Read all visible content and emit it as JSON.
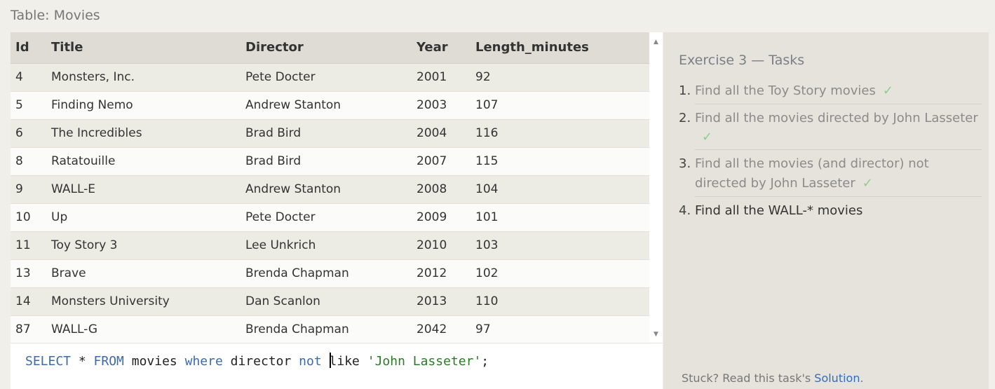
{
  "table": {
    "title": "Table: Movies",
    "columns": [
      "Id",
      "Title",
      "Director",
      "Year",
      "Length_minutes"
    ],
    "rows": [
      [
        "4",
        "Monsters, Inc.",
        "Pete Docter",
        "2001",
        "92"
      ],
      [
        "5",
        "Finding Nemo",
        "Andrew Stanton",
        "2003",
        "107"
      ],
      [
        "6",
        "The Incredibles",
        "Brad Bird",
        "2004",
        "116"
      ],
      [
        "8",
        "Ratatouille",
        "Brad Bird",
        "2007",
        "115"
      ],
      [
        "9",
        "WALL-E",
        "Andrew Stanton",
        "2008",
        "104"
      ],
      [
        "10",
        "Up",
        "Pete Docter",
        "2009",
        "101"
      ],
      [
        "11",
        "Toy Story 3",
        "Lee Unkrich",
        "2010",
        "103"
      ],
      [
        "13",
        "Brave",
        "Brenda Chapman",
        "2012",
        "102"
      ],
      [
        "14",
        "Monsters University",
        "Dan Scanlon",
        "2013",
        "110"
      ],
      [
        "87",
        "WALL-G",
        "Brenda Chapman",
        "2042",
        "97"
      ]
    ]
  },
  "scrollbar": {
    "up_icon": "triangle-up-icon",
    "down_icon": "triangle-down-icon"
  },
  "editor": {
    "tokens": [
      {
        "text": "SELECT",
        "type": "kw"
      },
      {
        "text": " * ",
        "type": "plain"
      },
      {
        "text": "FROM",
        "type": "kw"
      },
      {
        "text": " movies ",
        "type": "plain"
      },
      {
        "text": "where",
        "type": "kw"
      },
      {
        "text": " director ",
        "type": "plain"
      },
      {
        "text": "not",
        "type": "kw"
      },
      {
        "text": " ",
        "type": "plain"
      },
      {
        "text": "",
        "type": "cursor"
      },
      {
        "text": "like",
        "type": "plain"
      },
      {
        "text": " ",
        "type": "plain"
      },
      {
        "text": "'John Lasseter'",
        "type": "str"
      },
      {
        "text": ";",
        "type": "plain"
      }
    ],
    "colors": {
      "keyword": "#3d6aa8",
      "string": "#2b7b27"
    }
  },
  "exercise": {
    "title": "Exercise 3 — Tasks",
    "tasks": [
      {
        "num": "1.",
        "text": "Find all the Toy Story movies",
        "done": true,
        "check_wrap": false
      },
      {
        "num": "2.",
        "text": "Find all the movies directed by John Lasseter",
        "done": true,
        "check_wrap": true
      },
      {
        "num": "3.",
        "text": "Find all the movies (and director) not directed by John Lasseter",
        "done": true,
        "check_wrap": false
      },
      {
        "num": "4.",
        "text": "Find all the WALL-* movies",
        "done": false,
        "check_wrap": false
      }
    ],
    "check_mark": "✓",
    "check_color": "#8fcd8a"
  },
  "help": {
    "prefix": "Stuck? Read this task's ",
    "link": "Solution",
    "suffix": "."
  }
}
